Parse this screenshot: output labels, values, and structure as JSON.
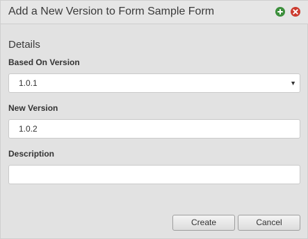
{
  "dialog": {
    "title": "Add a New Version to Form Sample Form",
    "add_icon": "plus-circle-icon",
    "close_icon": "close-circle-icon",
    "add_icon_color": "#3c8f3c",
    "close_icon_color": "#cc3b2f"
  },
  "details": {
    "heading": "Details",
    "based_on_version": {
      "label": "Based On Version",
      "selected": "1.0.1"
    },
    "new_version": {
      "label": "New Version",
      "value": "1.0.2"
    },
    "description": {
      "label": "Description",
      "value": ""
    }
  },
  "actions": {
    "create_label": "Create",
    "cancel_label": "Cancel"
  }
}
